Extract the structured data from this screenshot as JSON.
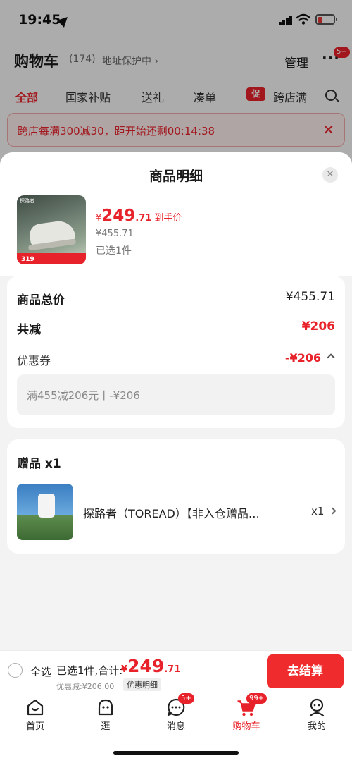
{
  "status_bar": {
    "time": "19:45"
  },
  "cart_header": {
    "title": "购物车",
    "count": "(174)",
    "address": "地址保护中 ›",
    "manage": "管理",
    "more": "···",
    "more_badge": "5+"
  },
  "cart_tabs": [
    "全部",
    "国家补贴",
    "送礼",
    "凑单",
    "跨店满"
  ],
  "cart_tab_promo_tag": "促",
  "promo_banner": {
    "text": "跨店每满300减30，距开始还剩00:14:38",
    "close": "✕"
  },
  "sheet": {
    "title": "商品明细",
    "close": "✕",
    "product": {
      "currency": "¥",
      "price_int": "249",
      "price_dec": ".71",
      "price_tag": "到手价",
      "original_price": "¥455.71",
      "selected": "已选1件",
      "thumb_price": "319",
      "thumb_brand": "探路者"
    },
    "summary": {
      "total_label": "商品总价",
      "total_value": "¥455.71",
      "reduce_label": "共减",
      "reduce_value": "¥206",
      "coupon_label": "优惠券",
      "coupon_value": "-¥206",
      "coupon_detail": "满455减206元丨-¥206"
    },
    "gift": {
      "title": "赠品 x1",
      "name": "探路者（TOREAD）【非入仓赠品…",
      "qty": "x1"
    }
  },
  "checkout": {
    "select_all": "全选",
    "summary": "已选1件,合计:",
    "currency": "¥",
    "total_int": "249",
    "total_dec": ".71",
    "discount_text": "优惠减:¥206.00",
    "detail_button": "优惠明细",
    "checkout_button": "去结算"
  },
  "tabbar": {
    "items": [
      {
        "label": "首页",
        "icon": "home-icon"
      },
      {
        "label": "逛",
        "icon": "face-icon"
      },
      {
        "label": "消息",
        "icon": "chat-icon",
        "badge": "5+"
      },
      {
        "label": "购物车",
        "icon": "cart-icon",
        "badge": "99+"
      },
      {
        "label": "我的",
        "icon": "person-icon"
      }
    ]
  },
  "colors": {
    "accent": "#e8222a",
    "checkout_button": "#ef2b2d",
    "sheet_bg": "#f3f3f3"
  }
}
